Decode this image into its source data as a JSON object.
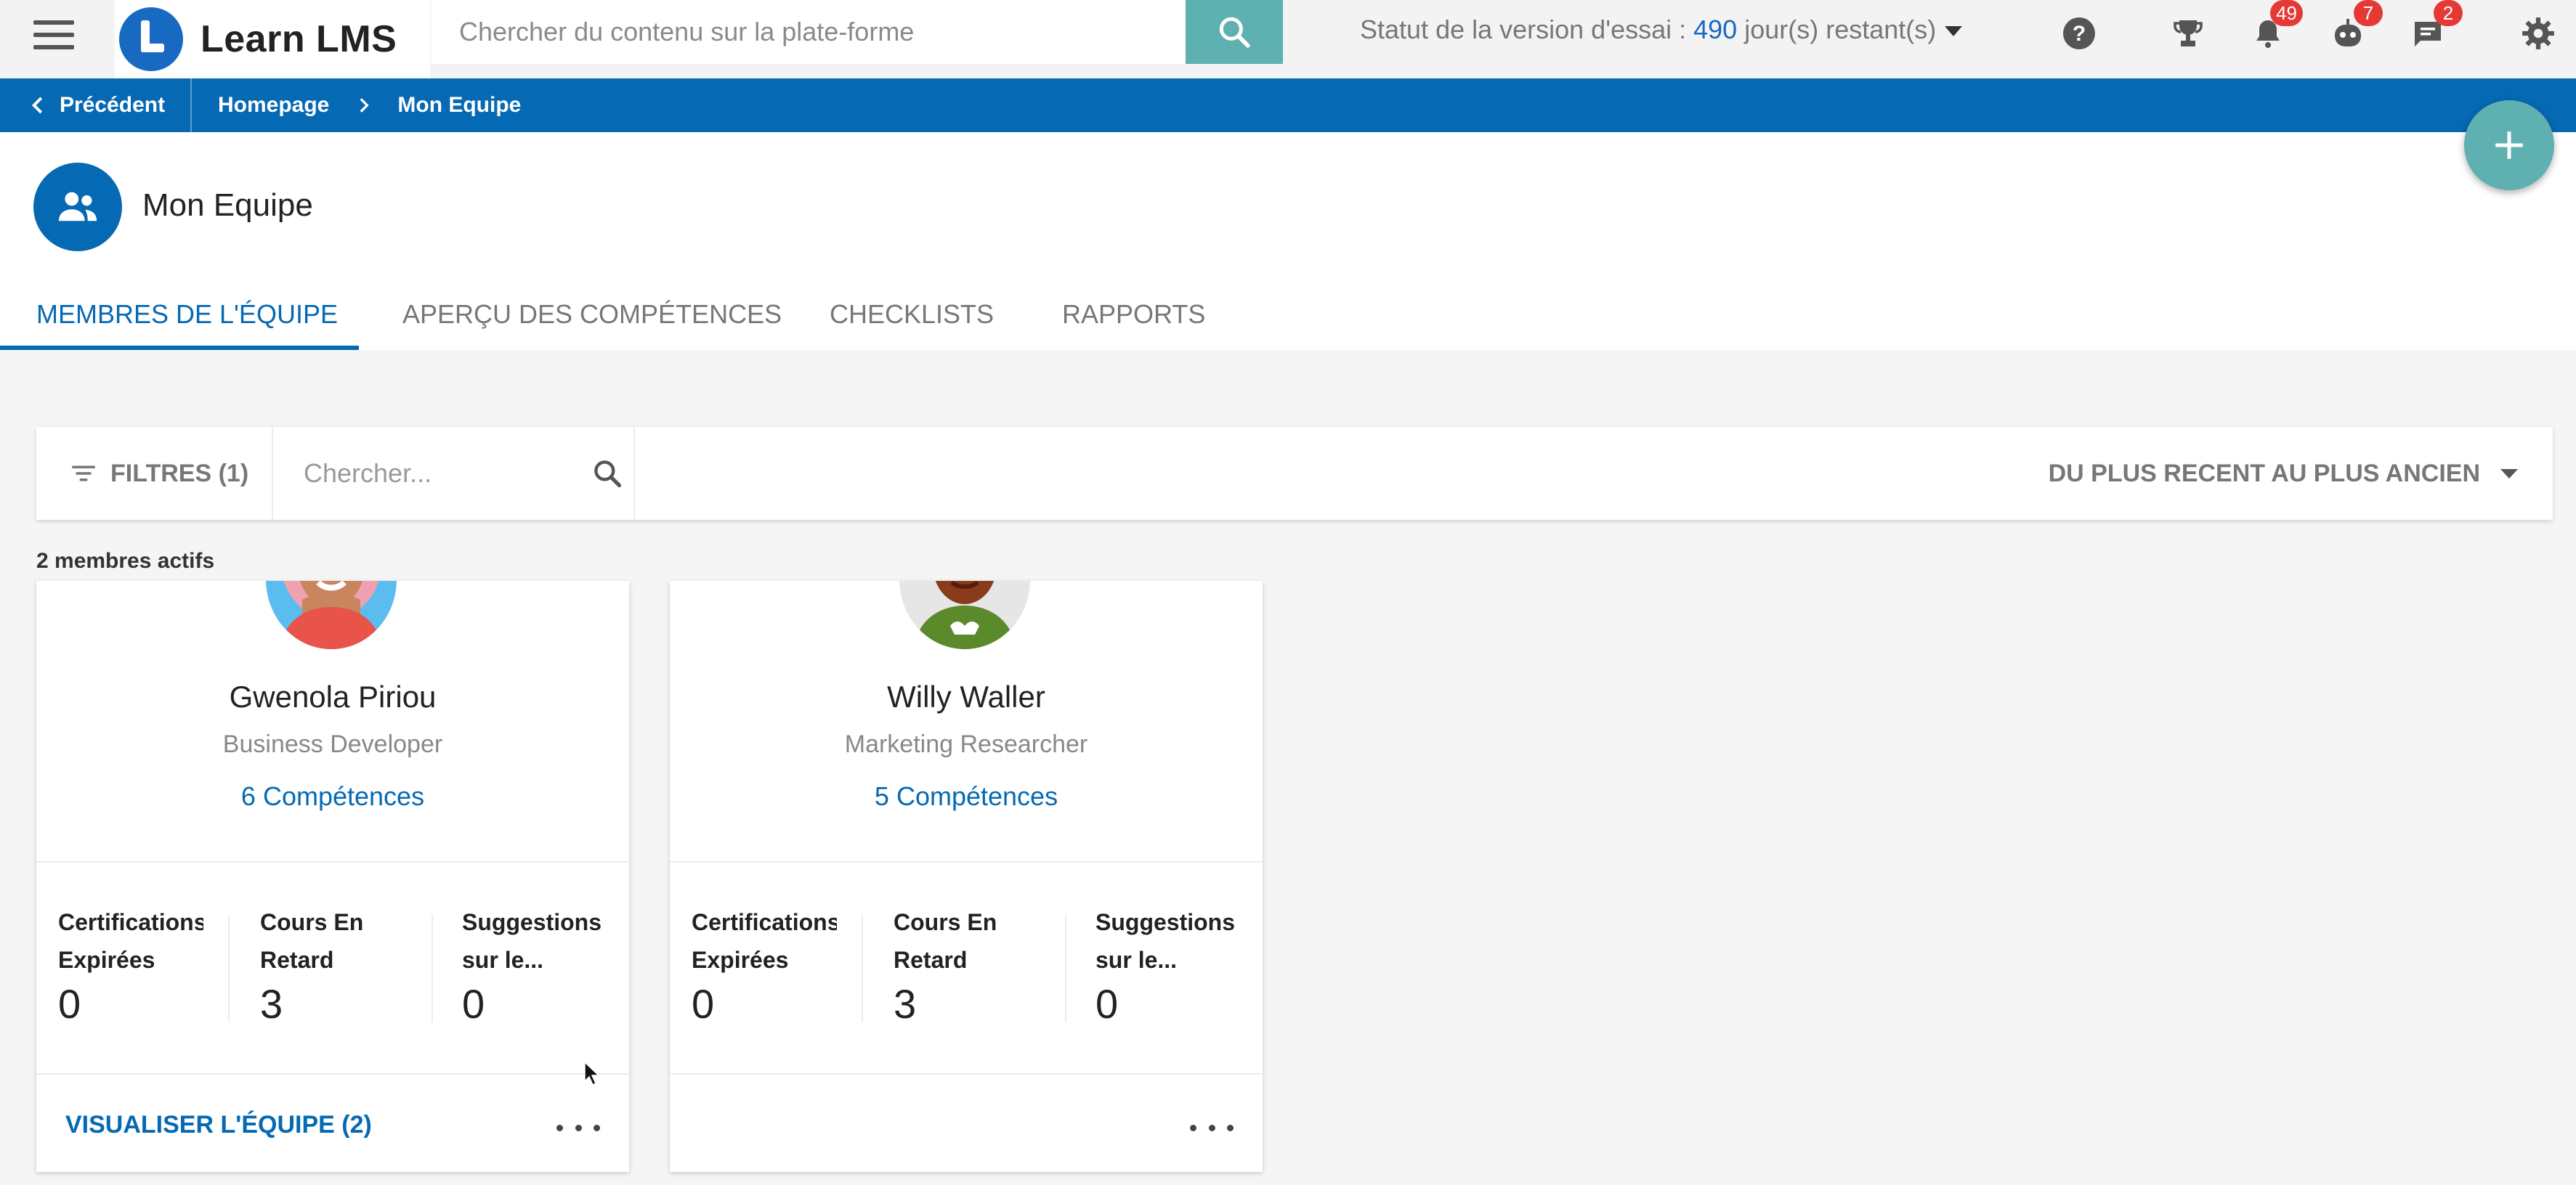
{
  "topbar": {
    "app_name": "Learn LMS",
    "search_placeholder": "Chercher du contenu sur la plate-forme",
    "trial_label": "Statut de la version d'essai :",
    "trial_days": "490",
    "trial_suffix": "jour(s) restant(s)",
    "notifications_count": "49",
    "bot_count": "7",
    "messages_count": "2"
  },
  "breadcrumb": {
    "back_label": "Précédent",
    "items": [
      "Homepage",
      "Mon Equipe"
    ]
  },
  "page": {
    "title": "Mon Equipe",
    "tabs": [
      "MEMBRES DE L'ÉQUIPE",
      "APERÇU DES COMPÉTENCES",
      "CHECKLISTS",
      "RAPPORTS"
    ],
    "active_tab": 0
  },
  "toolbar": {
    "filters_label": "FILTRES (1)",
    "search_placeholder": "Chercher...",
    "sort_label": "DU PLUS RECENT AU PLUS ANCIEN"
  },
  "members_count": "2 membres actifs",
  "members": [
    {
      "name": "Gwenola Piriou",
      "role": "Business Developer",
      "competences": "6 Compétences",
      "stats": [
        {
          "label1": "Certifications",
          "label2": "Expirées",
          "value": "0"
        },
        {
          "label1": "Cours En",
          "label2": "Retard",
          "value": "3"
        },
        {
          "label1": "Suggestions",
          "label2": "sur le...",
          "value": "0"
        }
      ],
      "footer_link": "VISUALISER L'ÉQUIPE (2)"
    },
    {
      "name": "Willy Waller",
      "role": "Marketing Researcher",
      "competences": "5 Compétences",
      "stats": [
        {
          "label1": "Certifications",
          "label2": "Expirées",
          "value": "0"
        },
        {
          "label1": "Cours En",
          "label2": "Retard",
          "value": "3"
        },
        {
          "label1": "Suggestions",
          "label2": "sur le...",
          "value": "0"
        }
      ],
      "footer_link": ""
    }
  ],
  "colors": {
    "primary": "#0569b3",
    "accent": "#5fb0b0",
    "badge": "#e53935"
  }
}
